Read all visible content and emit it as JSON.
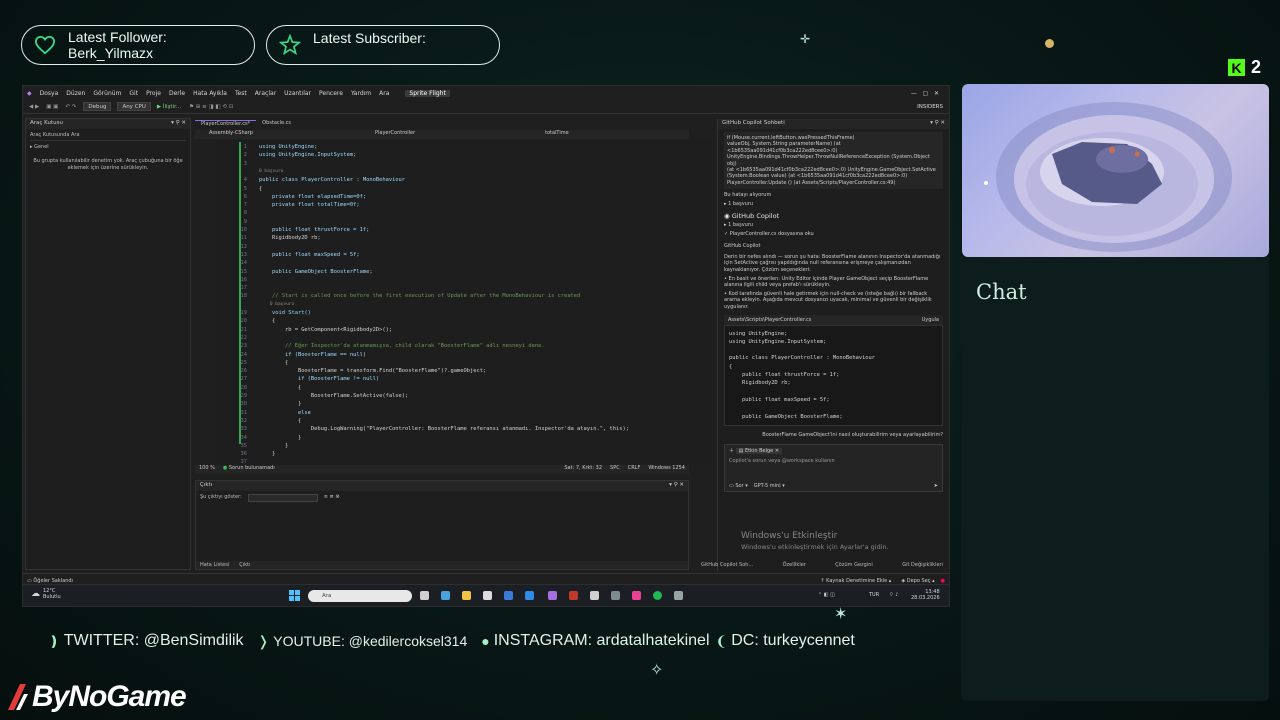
{
  "overlay": {
    "follower_label": "Latest Follower:",
    "follower_name": "Berk_Yilmazx",
    "subscriber_label": "Latest Subscriber:",
    "kick_viewers": "2",
    "chat_title": "Chat",
    "brand": "ByNoGame",
    "socials": [
      {
        "label": "TWITTER: @BenSimdilik"
      },
      {
        "label": "YOUTUBE: @kedilercoksel314"
      },
      {
        "label": "INSTAGRAM: ardatalhatekinel"
      },
      {
        "label": "DC: turkeycennet"
      }
    ],
    "accent_color": "#39d98a"
  },
  "ide": {
    "menu": [
      "Dosya",
      "Düzen",
      "Görünüm",
      "Git",
      "Proje",
      "Derle",
      "Hata Ayıkla",
      "Test",
      "Araçlar",
      "Uzantılar",
      "Pencere",
      "Yardım",
      "Ara"
    ],
    "solution_title": "Sprite Flight",
    "insiders": "INSIDERS",
    "config": "Debug",
    "platform": "Any CPU",
    "run_label": "İliştir...",
    "toolbox": {
      "title": "Araç Kutusu",
      "search": "Araç Kutusunda Ara",
      "group": "Genel",
      "empty": "Bu grupta kullanılabilir denetim yok. Araç çubuğuna bir öğe eklemek için üzerine sürükleyin."
    },
    "tabs": [
      "PlayerController.cs*",
      "Obstacle.cs"
    ],
    "nav": [
      "Assembly-CSharp",
      "PlayerController",
      "totalTime"
    ],
    "code_lines": [
      {
        "n": "1",
        "t": "using UnityEngine;"
      },
      {
        "n": "2",
        "t": "using UnityEngine.InputSystem;"
      },
      {
        "n": "3",
        "t": ""
      },
      {
        "n": "",
        "t": "0 başvuru"
      },
      {
        "n": "4",
        "t": "public class PlayerController : MonoBehaviour"
      },
      {
        "n": "5",
        "t": "{"
      },
      {
        "n": "6",
        "t": "    private float elapsedTime=0f;"
      },
      {
        "n": "7",
        "t": "    private float totalTime=0f;"
      },
      {
        "n": "8",
        "t": ""
      },
      {
        "n": "9",
        "t": ""
      },
      {
        "n": "10",
        "t": "    public float thrustForce = 1f;"
      },
      {
        "n": "11",
        "t": "    Rigidbody2D rb;"
      },
      {
        "n": "12",
        "t": ""
      },
      {
        "n": "13",
        "t": "    public float maxSpeed = 5f;"
      },
      {
        "n": "14",
        "t": ""
      },
      {
        "n": "15",
        "t": "    public GameObject BoosterFlame;"
      },
      {
        "n": "16",
        "t": ""
      },
      {
        "n": "17",
        "t": ""
      },
      {
        "n": "18",
        "t": "    // Start is called once before the first execution of Update after the MonoBehaviour is created"
      },
      {
        "n": "",
        "t": "    0 başvuru"
      },
      {
        "n": "19",
        "t": "    void Start()"
      },
      {
        "n": "20",
        "t": "    {"
      },
      {
        "n": "21",
        "t": "        rb = GetComponent<Rigidbody2D>();"
      },
      {
        "n": "22",
        "t": ""
      },
      {
        "n": "23",
        "t": "        // Eğer Inspector'da atanmamışsa, child olarak \"BoosterFlame\" adlı nesneyi dene."
      },
      {
        "n": "24",
        "t": "        if (BoosterFlame == null)"
      },
      {
        "n": "25",
        "t": "        {"
      },
      {
        "n": "26",
        "t": "            BoosterFlame = transform.Find(\"BoosterFlame\")?.gameObject;"
      },
      {
        "n": "27",
        "t": "            if (BoosterFlame != null)"
      },
      {
        "n": "28",
        "t": "            {"
      },
      {
        "n": "29",
        "t": "                BoosterFlame.SetActive(false);"
      },
      {
        "n": "30",
        "t": "            }"
      },
      {
        "n": "31",
        "t": "            else"
      },
      {
        "n": "32",
        "t": "            {"
      },
      {
        "n": "33",
        "t": "                Debug.LogWarning(\"PlayerController: BoosterFlame referansı atanmadı. Inspector'da atayın.\", this);"
      },
      {
        "n": "34",
        "t": "            }"
      },
      {
        "n": "35",
        "t": "        }"
      },
      {
        "n": "36",
        "t": "    }"
      },
      {
        "n": "37",
        "t": ""
      }
    ],
    "status": {
      "zoom": "100 %",
      "issues": "Sorun bulunamadı",
      "position": "Sat: 7, Krkt: 32",
      "encoding": "SPC",
      "eol": "CRLF",
      "codepage": "Windows 1254"
    },
    "output": {
      "title": "Çıktı",
      "source_label": "Şu çıktıyı göster:",
      "tabs": [
        "Hata Listesi",
        "Çıktı"
      ]
    },
    "copilot": {
      "title": "GitHub Copilot Sohbeti",
      "stack_lines": [
        "if (Mouse.current.leftButton.wasPressedThisFrame)",
        "valueObj, System.String parameterName) (at <1b6535aa091d41cf0b3ca222ed8cee0>:0)",
        "UnityEngine.Bindings.ThrowHelper.ThrowNullReferenceException (System.Object obj)",
        "(at <1b6535aa091d41cf0b3ca222ed8cee0>:0) UnityEngine.GameObject.SetActive",
        "(System.Boolean value) (at <1b6535aa091d41cf0b3ca222ed8cee0>:0)",
        "PlayerController.Update () (at Assets/Scripts/PlayerController.cs:49)"
      ],
      "question": "Bu hatayı alıyorum",
      "refs": "1 başvuru",
      "assistant": "GitHub Copilot",
      "refs2": "1 başvuru",
      "checked": "PlayerController.cs dosyasına oku",
      "assistant2": "GitHub Copilot",
      "answer": "Derin bir nefes alındı — sorun şu hata: BoosterFlame alanının Inspector'da atanmadığı için SetActive çağrısı yapıldığında null referansına erişmeye çalışmanızdan kaynaklanıyor. Çözüm seçenekleri:",
      "bullet1": "En basit ve önerilen: Unity Editor içinde Player GameObject seçip BoosterFlame alanına ilgili child veya prefab'ı sürükleyin.",
      "bullet2": "Kod tarafında güvenli hale getirmek için null-check ve (isteğe bağlı) bir fallback arama ekleyin. Aşağıda mevcut dosyanızı uyacak, minimal ve güvenli bir değişiklik uygulanır.",
      "file": "Assets\\Scripts\\PlayerController.cs",
      "apply": "Uygula",
      "snippet": [
        "using UnityEngine;",
        "using UnityEngine.InputSystem;",
        "",
        "public class PlayerController : MonoBehaviour",
        "{",
        "    public float thrustForce = 1f;",
        "    Rigidbody2D rb;",
        "",
        "    public float maxSpeed = 5f;",
        "",
        "    public GameObject BoosterFlame;"
      ],
      "followup": "BoosterFlame GameObject'ini nasıl oluşturabilirim veya ayarlayabilirim?",
      "context_chip": "Etkin Belge",
      "input_placeholder": "Copilot'a sorun veya @workspace kullanın",
      "mode": "Sor",
      "model": "GPT-5 mini",
      "watermark1": "Windows'u Etkinleştir",
      "watermark2": "Windows'u etkinleştirmek için Ayarlar'a gidin.",
      "bottom_tabs": [
        "GitHub Copilot Soh...",
        "Özellikler",
        "Çözüm Gezgini",
        "Git Değişiklikleri"
      ]
    },
    "statusline": {
      "left": "Öğeler Saklandı",
      "source_control": "Kaynak Denetimine Ekle",
      "repo": "Depo Seç"
    }
  },
  "taskbar": {
    "weather_temp": "12°C",
    "weather_desc": "Bulutlu",
    "search": "Ara",
    "lang": "TUR",
    "time": "13:48",
    "date": "28.03.2026"
  }
}
